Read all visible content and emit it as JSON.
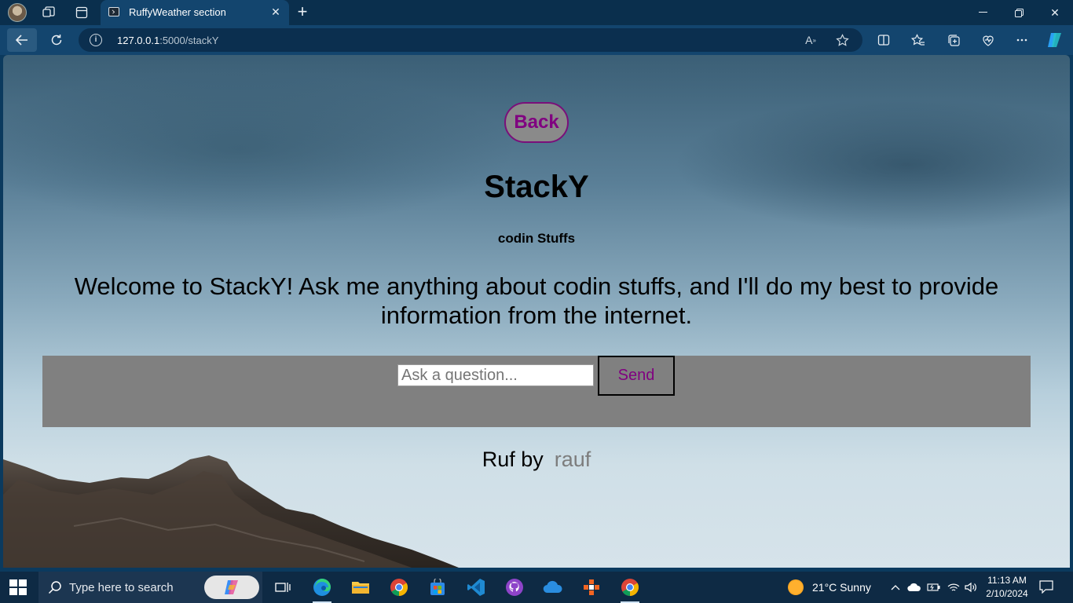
{
  "browser": {
    "tab_title": "RuffyWeather section",
    "url_host": "127.0.0.1",
    "url_path": ":5000/stackY"
  },
  "page": {
    "back_label": "Back",
    "title": "StackY",
    "subtitle": "codin Stuffs",
    "welcome": "Welcome to StackY! Ask me anything about codin stuffs, and I'll do my best to provide information from the internet.",
    "input_placeholder": "Ask a question...",
    "send_label": "Send",
    "footer_prefix": "Ruf by",
    "footer_author": "rauf"
  },
  "taskbar": {
    "search_placeholder": "Type here to search",
    "weather": "21°C  Sunny",
    "time": "11:13 AM",
    "date": "2/10/2024"
  },
  "colors": {
    "link_purple": "#800080",
    "chat_bg": "#808080",
    "browser_frame": "#13456e"
  }
}
